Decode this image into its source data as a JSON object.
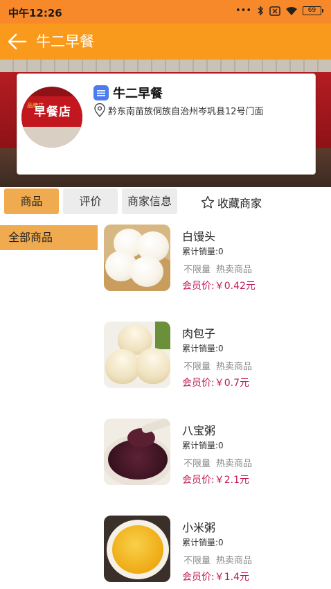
{
  "status_bar": {
    "time": "中午12:26",
    "dots": "•••",
    "battery": "69"
  },
  "app_bar": {
    "title": "牛二早餐"
  },
  "store": {
    "name": "牛二早餐",
    "address": "黔东南苗族侗族自治州岑巩县12号门面",
    "avatar_sign": "早餐店",
    "avatar_small": "品牌店"
  },
  "tabs": [
    {
      "label": "商品"
    },
    {
      "label": "评价"
    },
    {
      "label": "商家信息"
    }
  ],
  "favorite": {
    "label": "收藏商家"
  },
  "categories": [
    {
      "label": "全部商品"
    }
  ],
  "products": [
    {
      "name": "白馒头",
      "sales": "累计销量:0",
      "tag_limit": "不限量",
      "tag_hot": "热卖商品",
      "price": "会员价:￥0.42元"
    },
    {
      "name": "肉包子",
      "sales": "累计销量:0",
      "tag_limit": "不限量",
      "tag_hot": "热卖商品",
      "price": "会员价:￥0.7元"
    },
    {
      "name": "八宝粥",
      "sales": "累计销量:0",
      "tag_limit": "不限量",
      "tag_hot": "热卖商品",
      "price": "会员价:￥2.1元"
    },
    {
      "name": "小米粥",
      "sales": "累计销量:0",
      "tag_limit": "不限量",
      "tag_hot": "热卖商品",
      "price": "会员价:￥1.4元"
    }
  ],
  "colors": {
    "status_bar": "#f7892a",
    "app_bar": "#fa9a1c",
    "active_tab": "#f0aa4f",
    "price": "#c0185a"
  },
  "icons": [
    "back-arrow-icon",
    "bluetooth-icon",
    "sim-icon",
    "wifi-icon",
    "battery-icon",
    "store-badge-icon",
    "location-pin-icon",
    "star-outline-icon"
  ]
}
